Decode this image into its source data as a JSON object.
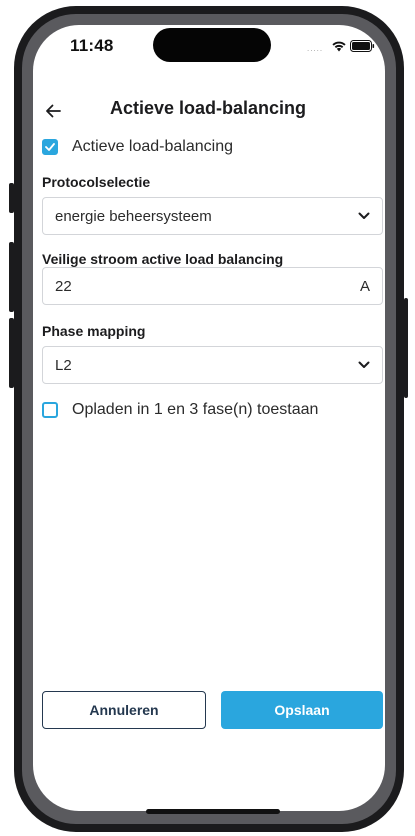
{
  "status_bar": {
    "time": "11:48",
    "signal": "....."
  },
  "header": {
    "title": "Actieve load-balancing"
  },
  "active_lb": {
    "label": "Actieve load-balancing",
    "checked": true
  },
  "protocol": {
    "label": "Protocolselectie",
    "value": "energie beheersysteem"
  },
  "safe_current": {
    "label": "Veilige stroom active load balancing",
    "value": "22",
    "unit": "A"
  },
  "phase_mapping": {
    "label": "Phase mapping",
    "value": "L2"
  },
  "phase_switch": {
    "label": "Opladen in 1 en 3 fase(n) toestaan",
    "checked": false
  },
  "actions": {
    "cancel_label": "Annuleren",
    "save_label": "Opslaan"
  },
  "colors": {
    "accent": "#2aa6de",
    "navy": "#24384f",
    "border": "#d3d5d9"
  }
}
